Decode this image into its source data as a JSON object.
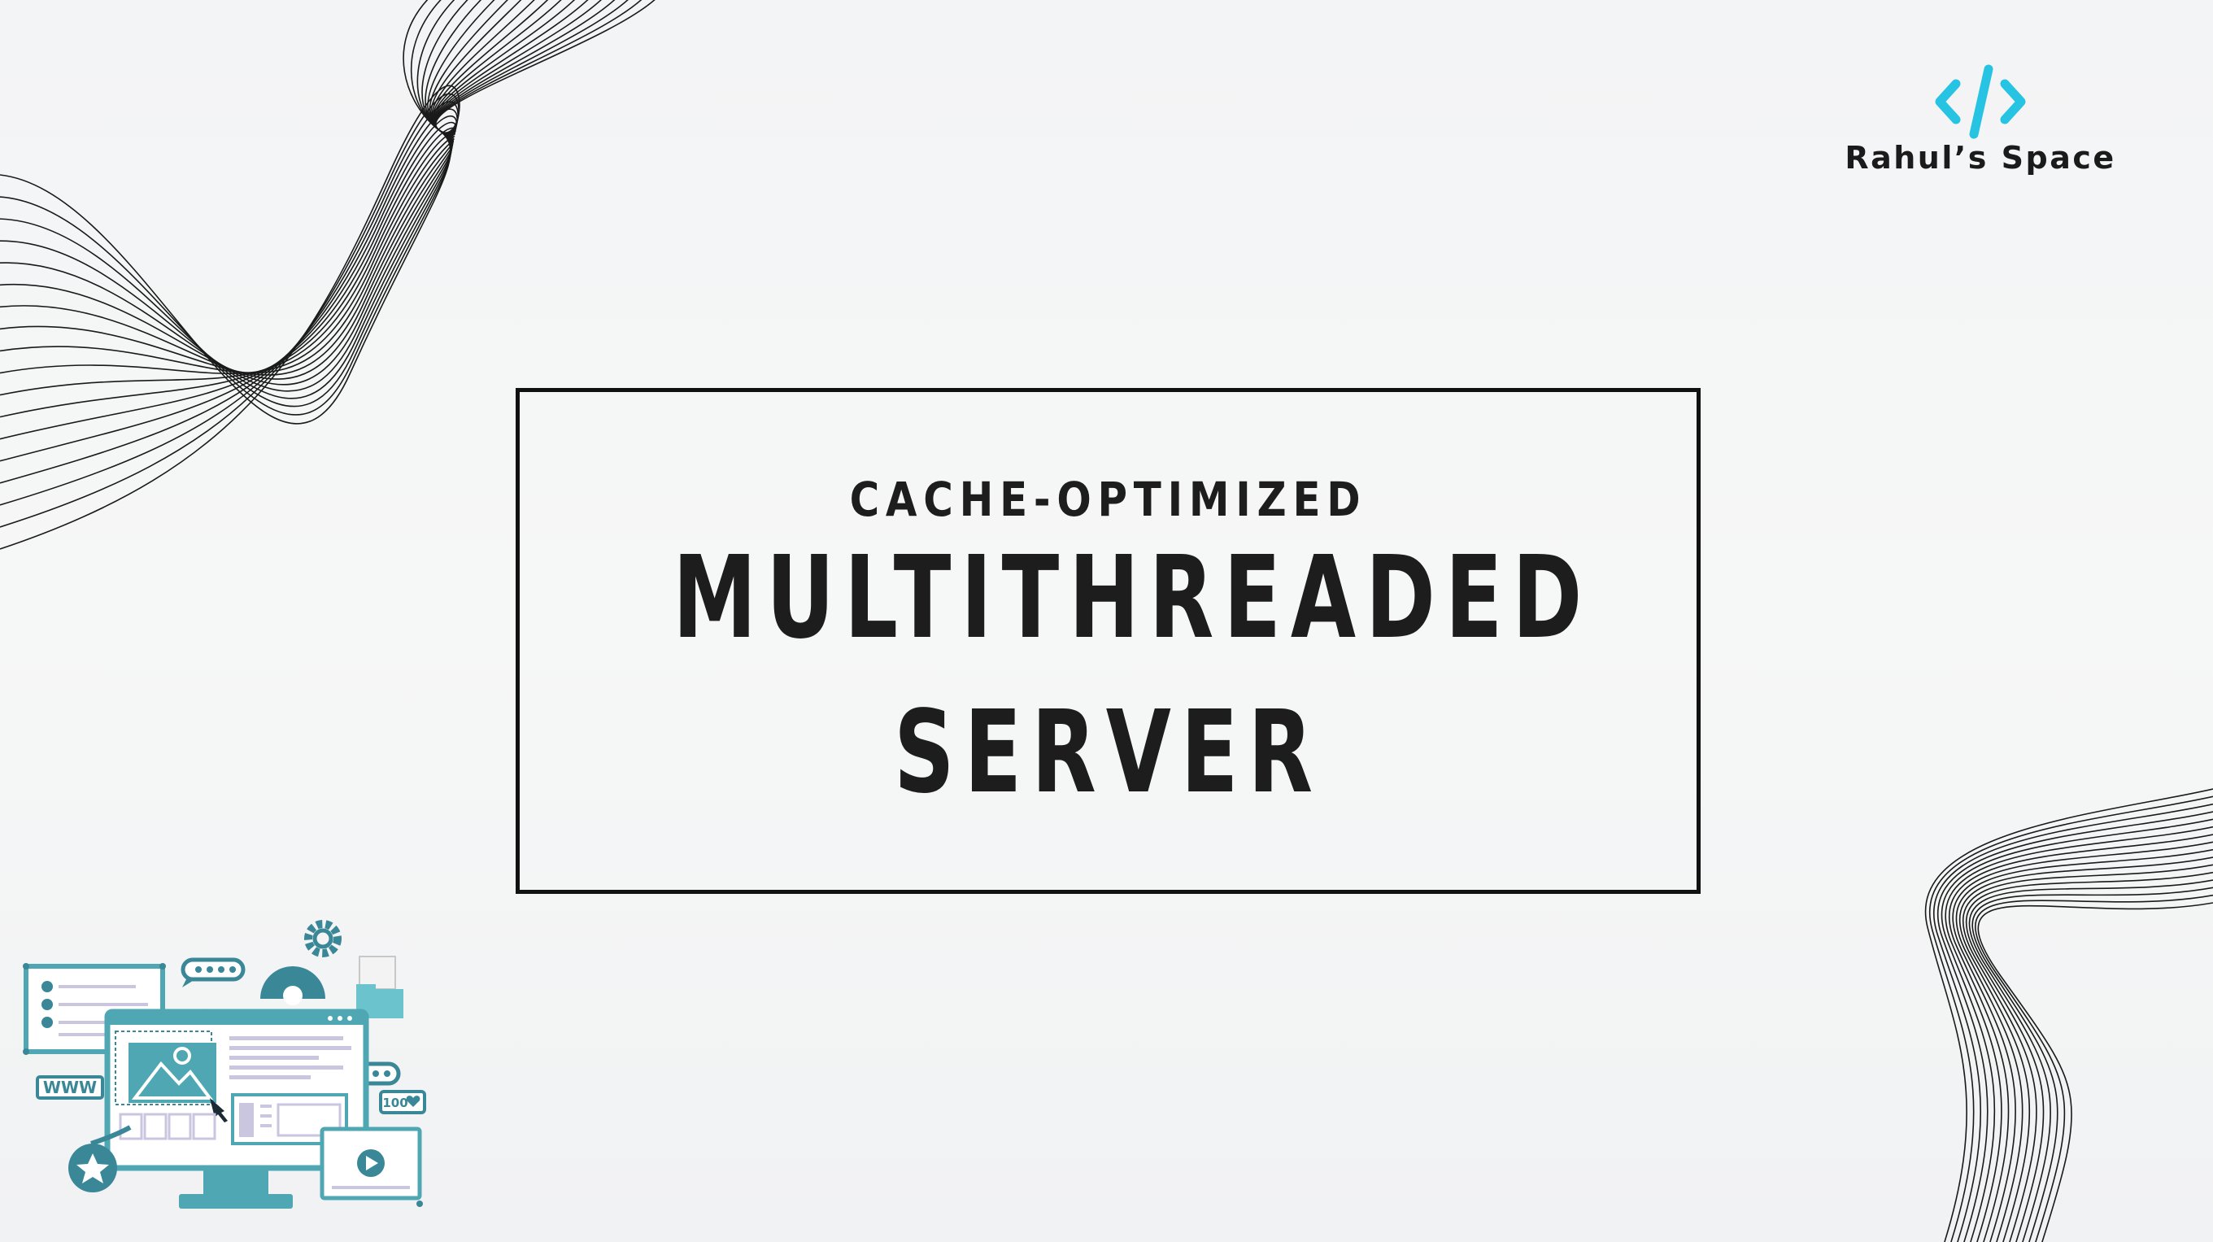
{
  "brand": {
    "name": "Rahul’s Space",
    "icon": "code-brackets-icon",
    "accent_color": "#27c3e3"
  },
  "title": {
    "subtitle": "CACHE-OPTIMIZED",
    "line1": "MULTITHREADED",
    "line2": "SERVER"
  },
  "illustration": {
    "icon": "web-design-illustration",
    "www_label": "WWW",
    "count_label": "100",
    "primary_color": "#4ea7b3",
    "secondary_color": "#3a8797",
    "light_color": "#cde7ea"
  },
  "colors": {
    "text": "#1d1d1d",
    "background": "#f4f5f6",
    "line_art": "#1a1a1a"
  }
}
